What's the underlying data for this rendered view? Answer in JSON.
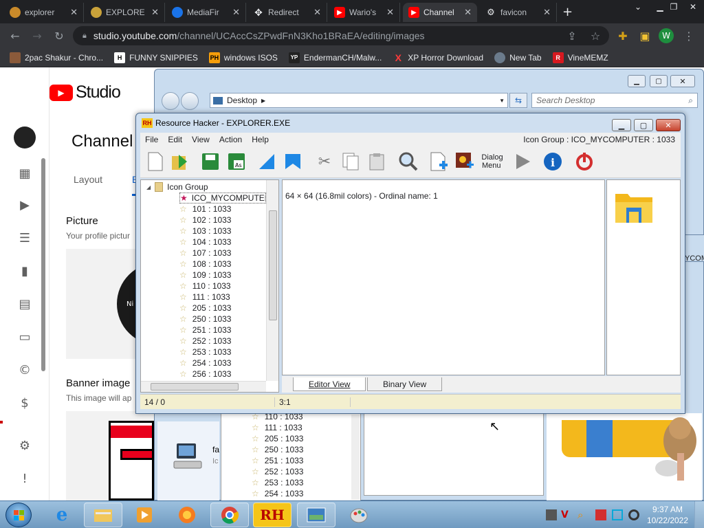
{
  "chrome": {
    "tabs": [
      {
        "label": "explorer",
        "color": "#c98a2a"
      },
      {
        "label": "EXPLORE",
        "color": "#c9a23a"
      },
      {
        "label": "MediaFir",
        "color": "#1a73e8"
      },
      {
        "label": "Redirect",
        "color": "#9aa0a6"
      },
      {
        "label": "Wario's",
        "color": "#ff0000"
      },
      {
        "label": "Channel",
        "color": "#ff0000"
      },
      {
        "label": "favicon",
        "color": "#9aa0a6"
      }
    ],
    "url_host": "studio.youtube.com",
    "url_path": "/channel/UCAccCsZPwdFnN3Kho1BRaEA/editing/images",
    "profile_initial": "W",
    "bookmarks": [
      {
        "label": "2pac Shakur - Chro...",
        "icon": "2pac-icon",
        "badge": ""
      },
      {
        "label": "FUNNY SNIPPIES",
        "icon": "h-icon",
        "badge": "H"
      },
      {
        "label": "windows ISOS",
        "icon": "ph-icon",
        "badge": "PH"
      },
      {
        "label": "EndermanCH/Malw...",
        "icon": "yp-icon",
        "badge": "YP"
      },
      {
        "label": "XP Horror Download",
        "icon": "x-icon",
        "badge": "X"
      },
      {
        "label": "New Tab",
        "icon": "globe-icon",
        "badge": ""
      },
      {
        "label": "VineMEMZ",
        "icon": "r-icon",
        "badge": "R"
      }
    ]
  },
  "studio": {
    "logo_text": "Studio",
    "page_title": "Channel",
    "tab_layout": "Layout",
    "tab_branding_partial": "B",
    "picture_heading": "Picture",
    "picture_desc": "Your profile pictur",
    "avatar_text": "Ni",
    "banner_heading": "Banner image",
    "banner_desc": "This image will ap"
  },
  "explorer": {
    "location": "Desktop",
    "search_placeholder": "Search Desktop",
    "tree_items": [
      "110 : 1033",
      "111 : 1033",
      "205 : 1033",
      "250 : 1033",
      "251 : 1033",
      "252 : 1033",
      "253 : 1033",
      "254 : 1033"
    ],
    "behind_label": "YCOM",
    "side_item_label": "fa",
    "side_item_sub": "Ic"
  },
  "rh": {
    "title": "Resource Hacker - EXPLORER.EXE",
    "menu": [
      "File",
      "Edit",
      "View",
      "Action",
      "Help"
    ],
    "context": "Icon Group : ICO_MYCOMPUTER : 1033",
    "dialog_label_1": "Dialog",
    "dialog_label_2": "Menu",
    "tree_root": "Icon Group",
    "tree_selected": "ICO_MYCOMPUTER",
    "tree_items": [
      "101 : 1033",
      "102 : 1033",
      "103 : 1033",
      "104 : 1033",
      "107 : 1033",
      "108 : 1033",
      "109 : 1033",
      "110 : 1033",
      "111 : 1033",
      "205 : 1033",
      "250 : 1033",
      "251 : 1033",
      "252 : 1033",
      "253 : 1033",
      "254 : 1033",
      "256 : 1033"
    ],
    "editor_text": "64 × 64 (16.8mil colors) - Ordinal name: 1",
    "tab_editor": "Editor View",
    "tab_binary": "Binary View",
    "status_left": "14 / 0",
    "status_mid": "3:1"
  },
  "taskbar": {
    "time": "9:37 AM",
    "date": "10/22/2022",
    "rh_label": "RH"
  }
}
